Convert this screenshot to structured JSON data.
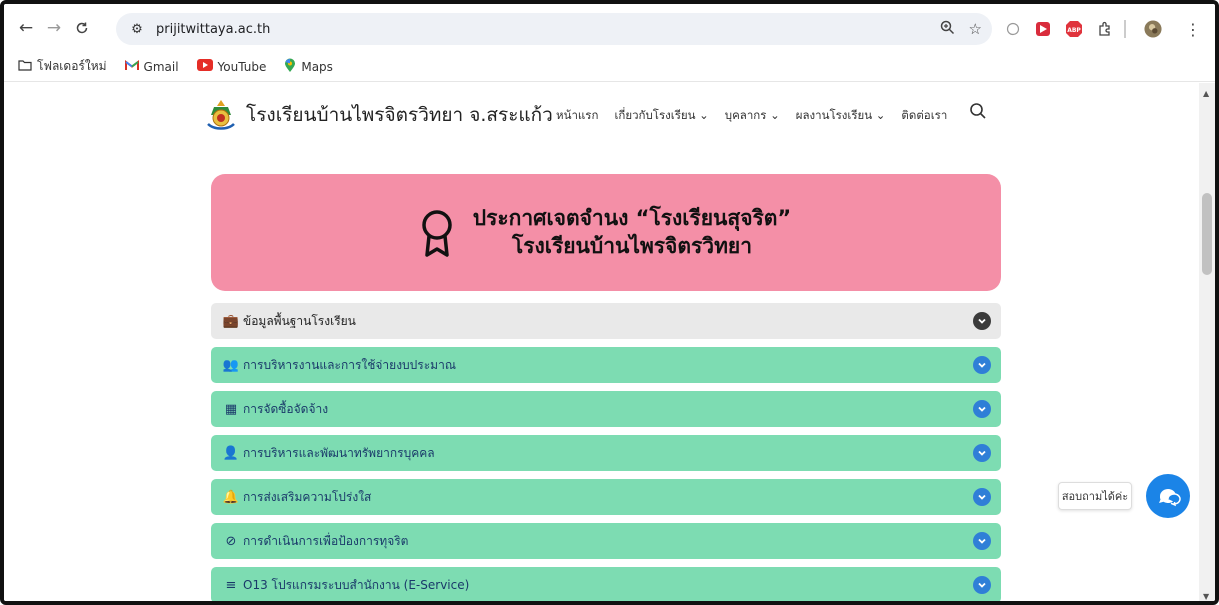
{
  "browser": {
    "url": "prijitwittaya.ac.th",
    "bookmarks": [
      {
        "label": "โฟลเดอร์ใหม่",
        "icon": "folder-icon"
      },
      {
        "label": "Gmail",
        "icon": "gmail-icon"
      },
      {
        "label": "YouTube",
        "icon": "youtube-icon"
      },
      {
        "label": "Maps",
        "icon": "maps-icon"
      }
    ]
  },
  "site": {
    "title": "โรงเรียนบ้านไพรจิตรวิทยา จ.สระแก้ว",
    "menu": [
      "หน้าแรก",
      "เกี่ยวกับโรงเรียน ⌄",
      "บุคลากร ⌄",
      "ผลงานโรงเรียน ⌄",
      "ติดต่อเรา"
    ]
  },
  "banner": {
    "line1": "ประกาศเจตจำนง “โรงเรียนสุจริต”",
    "line2": "โรงเรียนบ้านไพรจิตรวิทยา"
  },
  "accordion": [
    {
      "label": "ข้อมูลพื้นฐานโรงเรียน",
      "icon": "briefcase-icon",
      "icon_glyph": "💼",
      "style": "grey"
    },
    {
      "label": "การบริหารงานและการใช้จ่ายงบประมาณ",
      "icon": "users-icon",
      "icon_glyph": "👥",
      "style": "green"
    },
    {
      "label": "การจัดซื้อจัดจ้าง",
      "icon": "calculator-icon",
      "icon_glyph": "▦",
      "style": "green"
    },
    {
      "label": "การบริหารและพัฒนาทรัพยากรบุคคล",
      "icon": "user-icon",
      "icon_glyph": "👤",
      "style": "green"
    },
    {
      "label": "การส่งเสริมความโปร่งใส",
      "icon": "bell-icon",
      "icon_glyph": "🔔",
      "style": "green"
    },
    {
      "label": "การดำเนินการเพื่อป้องการทุจริต",
      "icon": "ban-icon",
      "icon_glyph": "⊘",
      "style": "green"
    },
    {
      "label": "O13 โปรแกรมระบบสำนักงาน (E-Service)",
      "icon": "list-icon",
      "icon_glyph": "≡",
      "style": "green"
    }
  ],
  "chat": {
    "label": "สอบถามได้ค่ะ"
  },
  "colors": {
    "banner": "#f48fa7",
    "accordion_green": "#7ddcb2",
    "chevron_blue": "#2f7fd7",
    "chat_blue": "#1b84e7"
  }
}
